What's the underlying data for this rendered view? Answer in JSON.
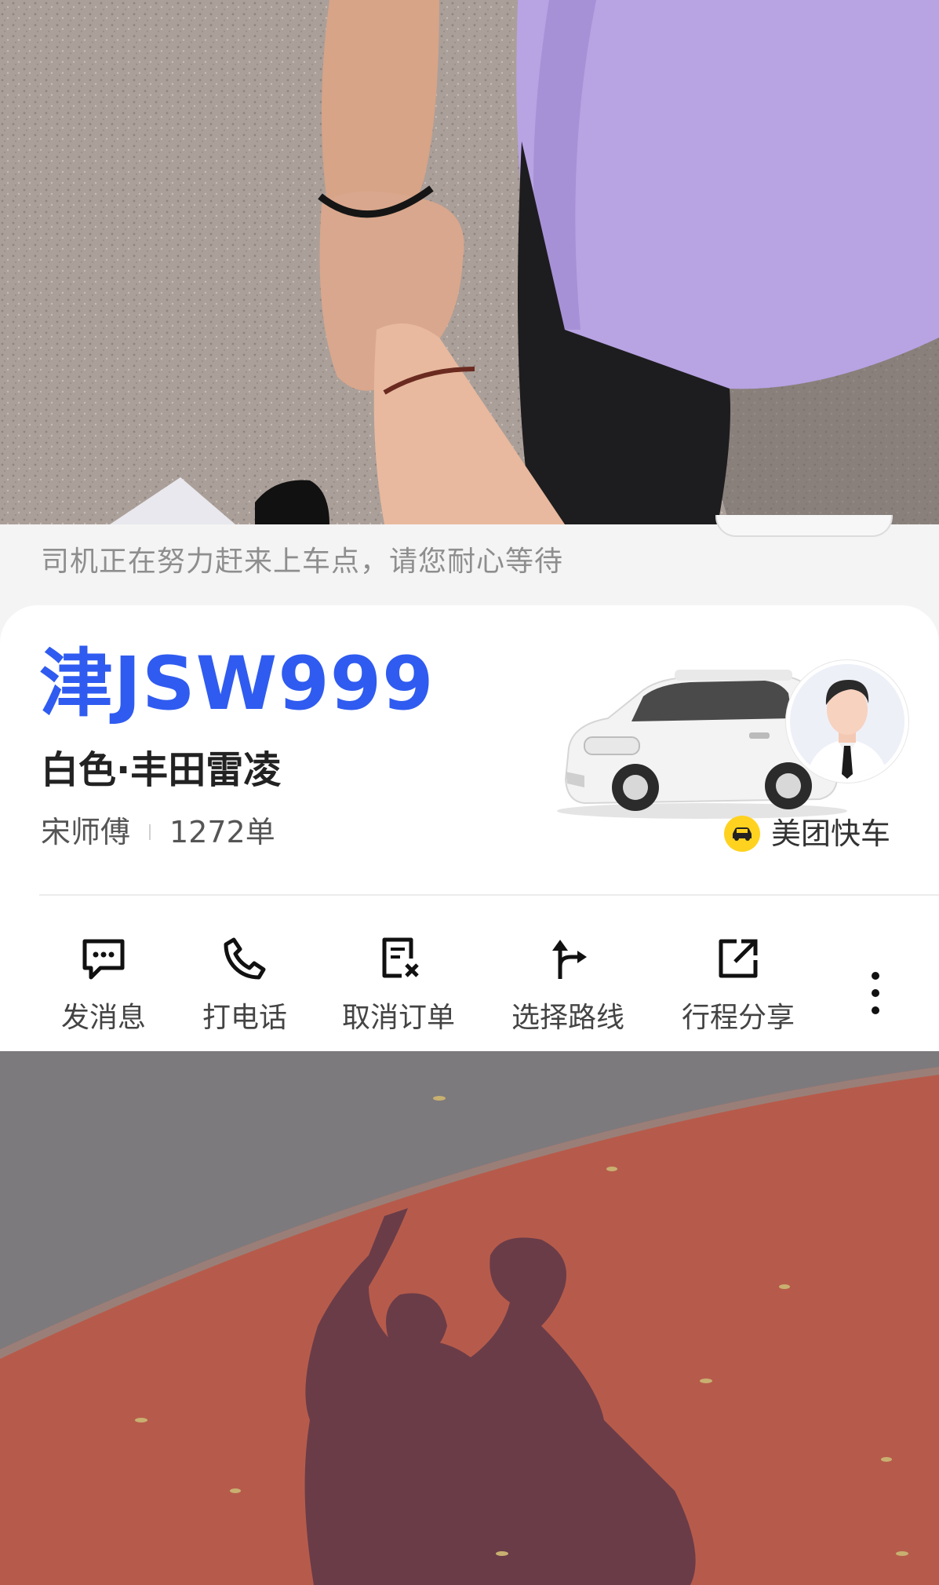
{
  "status": {
    "message": "司机正在努力赶来上车点，请您耐心等待"
  },
  "vehicle": {
    "plate": "津JSW999",
    "description": "白色·丰田雷凌"
  },
  "driver": {
    "name": "宋师傅",
    "orders": "1272单"
  },
  "service": {
    "name": "美团快车",
    "icon": "car-icon"
  },
  "actions": [
    {
      "label": "发消息",
      "icon": "message-icon"
    },
    {
      "label": "打电话",
      "icon": "phone-icon"
    },
    {
      "label": "取消订单",
      "icon": "cancel-order-icon"
    },
    {
      "label": "选择路线",
      "icon": "route-icon"
    },
    {
      "label": "行程分享",
      "icon": "share-icon"
    }
  ],
  "more_icon": "more-vertical-icon",
  "colors": {
    "plate": "#2f5bf0",
    "service_badge": "#ffd21f"
  }
}
